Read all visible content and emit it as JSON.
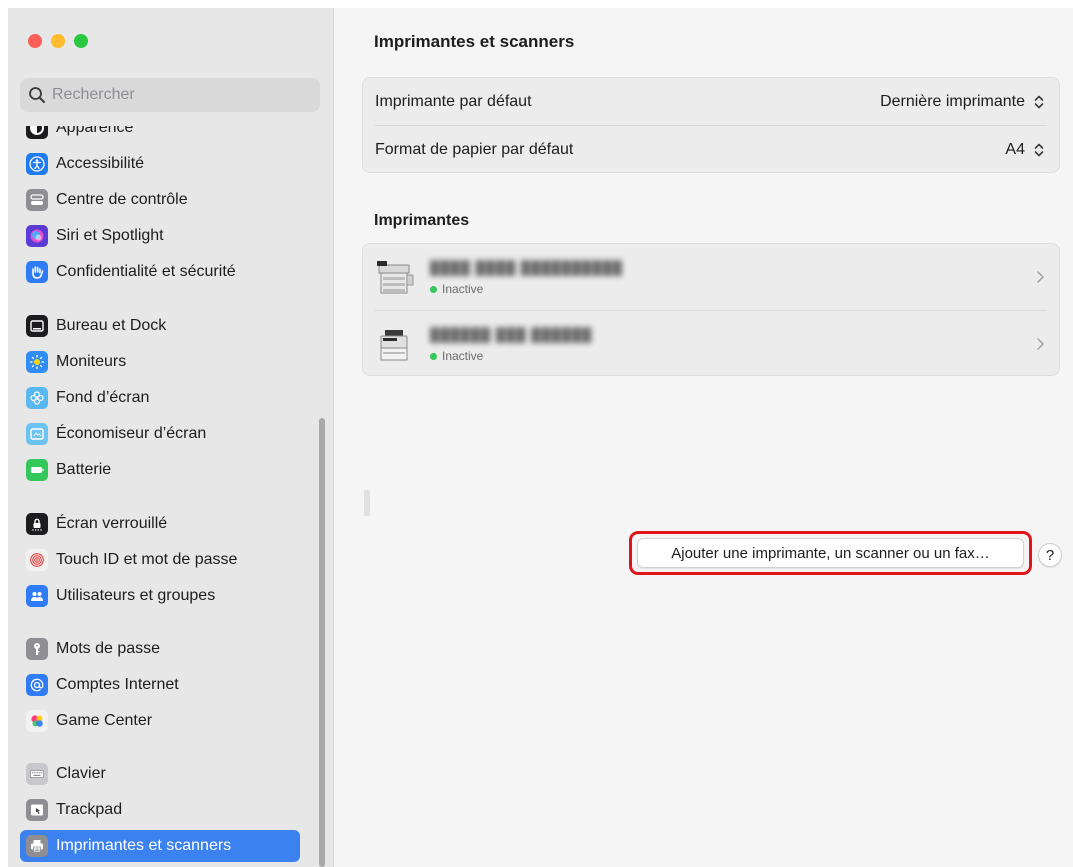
{
  "window": {
    "traffic_lights": [
      {
        "name": "close",
        "color": "#fe5f57"
      },
      {
        "name": "minimize",
        "color": "#febc2e"
      },
      {
        "name": "zoom",
        "color": "#28c840"
      }
    ]
  },
  "sidebar": {
    "search_placeholder": "Rechercher",
    "items": [
      {
        "label": "Apparence",
        "icon": "appearance-icon",
        "color": "#1c1c1e"
      },
      {
        "label": "Accessibilité",
        "icon": "accessibility-icon",
        "color": "#1f7bf2"
      },
      {
        "label": "Centre de contrôle",
        "icon": "control-center-icon",
        "color": "#8e8e93"
      },
      {
        "label": "Siri et Spotlight",
        "icon": "siri-icon",
        "color": "#5b3bd6"
      },
      {
        "label": "Confidentialité et sécurité",
        "icon": "privacy-hand-icon",
        "color": "#2f7cf6"
      },
      {
        "label": "Bureau et Dock",
        "icon": "desktop-dock-icon",
        "color": "#1c1c1e"
      },
      {
        "label": "Moniteurs",
        "icon": "displays-icon",
        "color": "#2f8df5"
      },
      {
        "label": "Fond d’écran",
        "icon": "wallpaper-icon",
        "color": "#5ab8f0"
      },
      {
        "label": "Économiseur d’écran",
        "icon": "screensaver-icon",
        "color": "#6cc3ef"
      },
      {
        "label": "Batterie",
        "icon": "battery-icon",
        "color": "#34c759"
      },
      {
        "label": "Écran verrouillé",
        "icon": "lock-screen-icon",
        "color": "#1c1c1e"
      },
      {
        "label": "Touch ID et mot de passe",
        "icon": "fingerprint-icon",
        "color": "#f2f2f2"
      },
      {
        "label": "Utilisateurs et groupes",
        "icon": "users-icon",
        "color": "#2f7cf6"
      },
      {
        "label": "Mots de passe",
        "icon": "key-icon",
        "color": "#8e8e93"
      },
      {
        "label": "Comptes Internet",
        "icon": "at-sign-icon",
        "color": "#2f7cf6"
      },
      {
        "label": "Game Center",
        "icon": "game-center-icon",
        "color": "#f2f2f2"
      },
      {
        "label": "Clavier",
        "icon": "keyboard-icon",
        "color": "#c7c7cc"
      },
      {
        "label": "Trackpad",
        "icon": "trackpad-icon",
        "color": "#8e8e93"
      },
      {
        "label": "Imprimantes et scanners",
        "icon": "printer-icon",
        "color": "#8e8e93",
        "selected": true
      }
    ]
  },
  "main": {
    "title": "Imprimantes et scanners",
    "defaults": [
      {
        "label": "Imprimante par défaut",
        "value": "Dernière imprimante"
      },
      {
        "label": "Format de papier par défaut",
        "value": "A4"
      }
    ],
    "printers_heading": "Imprimantes",
    "printers": [
      {
        "name": "████ ████ ██████████",
        "status": "Inactive",
        "status_color": "#34c759"
      },
      {
        "name": "██████ ███ ██████",
        "status": "Inactive",
        "status_color": "#34c759"
      }
    ],
    "add_button_label": "Ajouter une imprimante, un scanner ou un fax…",
    "help_label": "?",
    "highlight_color": "#e0141b",
    "accent_color": "#3b82f0"
  }
}
